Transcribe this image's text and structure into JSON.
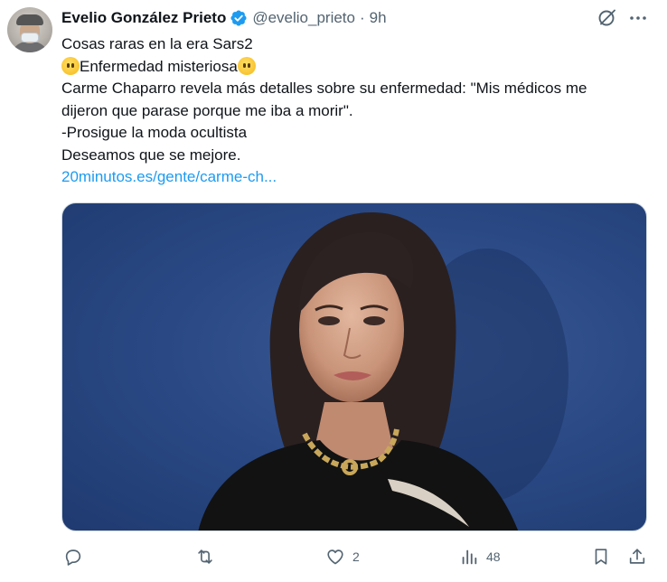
{
  "author": {
    "name": "Evelio González Prieto",
    "handle": "@evelio_prieto",
    "separator": "·",
    "time": "9h"
  },
  "tweet": {
    "lines": [
      "Cosas raras en la era Sars2",
      "Enfermedad misteriosa",
      "Carme Chaparro revela más detalles sobre su enfermedad: \"Mis médicos me",
      "dijeron que parase porque me iba a morir\".",
      "-Prosigue la moda ocultista",
      "Deseamos que se mejore."
    ],
    "link": "20minutos.es/gente/carme-ch..."
  },
  "actions": {
    "reply_count": "",
    "retweet_count": "",
    "like_count": "2",
    "views_count": "48"
  },
  "icons": {
    "verified": "verified-badge-icon",
    "grok": "grok-icon",
    "more": "more-icon",
    "reply": "reply-icon",
    "retweet": "retweet-icon",
    "like": "like-icon",
    "views": "views-icon",
    "bookmark": "bookmark-icon",
    "share": "share-icon"
  },
  "colors": {
    "accent": "#1d9bf0",
    "text": "#0f1419",
    "secondary": "#536471"
  }
}
